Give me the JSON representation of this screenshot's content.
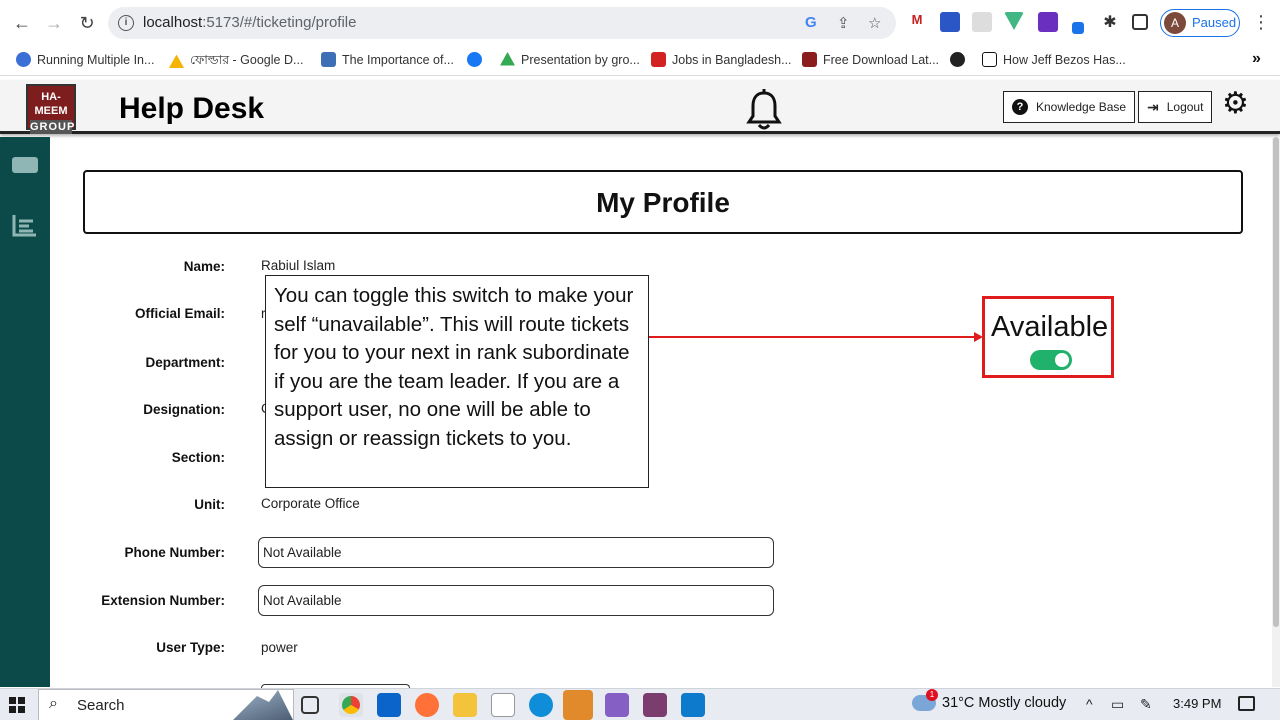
{
  "browser": {
    "url_host": "localhost",
    "url_path": ":5173/#/ticketing/profile",
    "profile_initial": "A",
    "profile_status": "Paused",
    "bookmarks": [
      {
        "label": "Running Multiple In...",
        "color": "#3b6fd6"
      },
      {
        "label": "ফোল্ডার - Google D...",
        "color": "#f4b400"
      },
      {
        "label": "The Importance of...",
        "color": "#3d6fb6"
      },
      {
        "label": "",
        "color": "#1877f2"
      },
      {
        "label": "Presentation by gro...",
        "color": "#34a853"
      },
      {
        "label": "Jobs in Bangladesh...",
        "color": "#d32222"
      },
      {
        "label": "Free Download Lat...",
        "color": "#8b1d1d"
      },
      {
        "label": "",
        "color": "#222222"
      },
      {
        "label": "How Jeff Bezos Has...",
        "color": "#111111"
      }
    ],
    "bookmarks_more": "»"
  },
  "header": {
    "logo_line1": "HA-MEEM",
    "logo_line2": "GROUP",
    "title": "Help Desk",
    "knowledge_base": "Knowledge Base",
    "logout": "Logout"
  },
  "profile": {
    "heading": "My Profile",
    "fields": {
      "name_label": "Name:",
      "name_value": "Rabiul Islam",
      "email_label": "Official Email:",
      "email_value": "r",
      "department_label": "Department:",
      "designation_label": "Designation:",
      "designation_value": "C",
      "section_label": "Section:",
      "unit_label": "Unit:",
      "unit_value": "Corporate Office",
      "phone_label": "Phone Number:",
      "phone_value": "Not Available",
      "extension_label": "Extension Number:",
      "extension_value": "Not Available",
      "usertype_label": "User Type:",
      "usertype_value": "power"
    },
    "availability_label": "Available",
    "available": true
  },
  "callout": {
    "text": "You can toggle this switch to make your self “unavailable”. This will route tickets for you to your next in rank subordinate if you are the team leader. If you are a support user, no one will be able to assign or reassign tickets to you."
  },
  "taskbar": {
    "search_text": "Search",
    "weather_badge": "1",
    "weather_text": "31°C  Mostly cloudy",
    "time": "3:49 PM"
  },
  "colors": {
    "sidebar": "#0c4a4a",
    "accent_red": "#e01b1b",
    "toggle_on": "#20b26b"
  }
}
